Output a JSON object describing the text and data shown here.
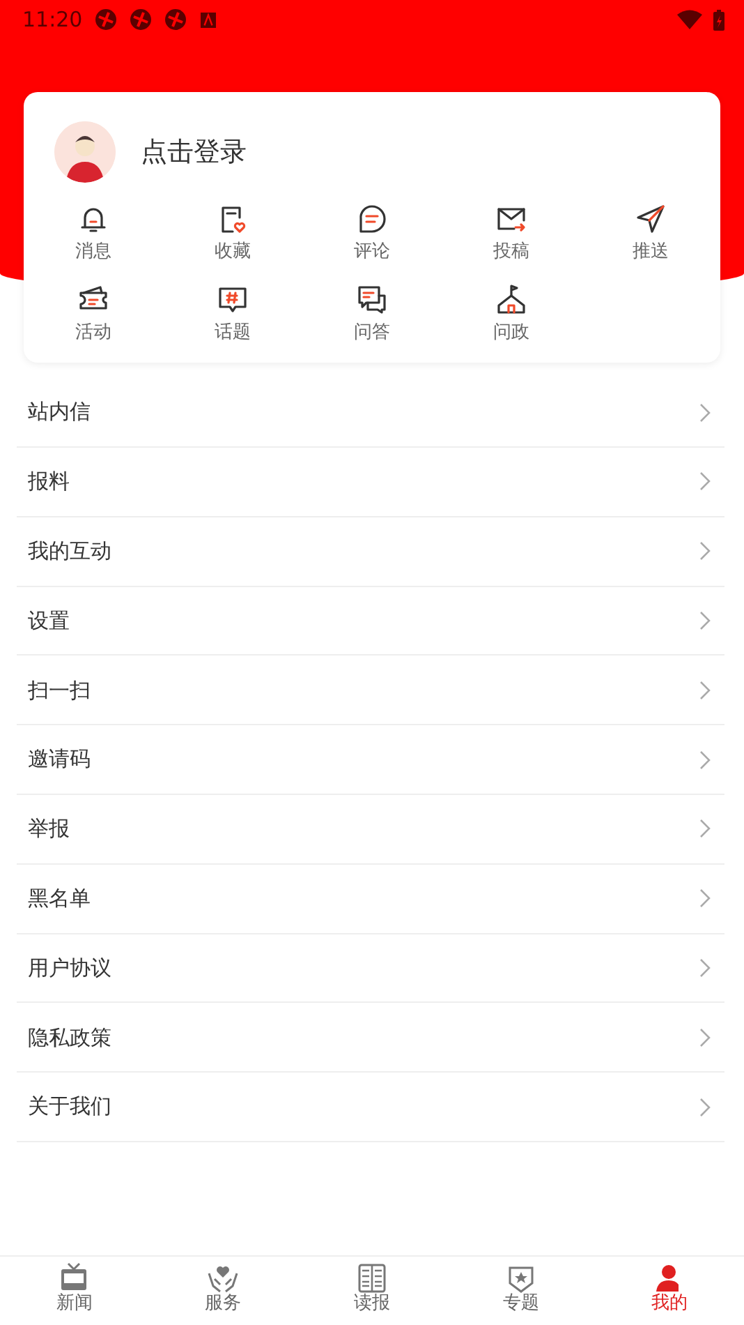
{
  "status_bar": {
    "time": "11:20"
  },
  "profile": {
    "login_label": "点击登录"
  },
  "shortcuts": [
    {
      "label": "消息"
    },
    {
      "label": "收藏"
    },
    {
      "label": "评论"
    },
    {
      "label": "投稿"
    },
    {
      "label": "推送"
    },
    {
      "label": "活动"
    },
    {
      "label": "话题"
    },
    {
      "label": "问答"
    },
    {
      "label": "问政"
    }
  ],
  "menu": [
    {
      "label": "站内信"
    },
    {
      "label": "报料"
    },
    {
      "label": "我的互动"
    },
    {
      "label": "设置"
    },
    {
      "label": "扫一扫"
    },
    {
      "label": "邀请码"
    },
    {
      "label": "举报"
    },
    {
      "label": "黑名单"
    },
    {
      "label": "用户协议"
    },
    {
      "label": "隐私政策"
    },
    {
      "label": "关于我们"
    }
  ],
  "bottom_nav": [
    {
      "label": "新闻",
      "selected": false
    },
    {
      "label": "服务",
      "selected": false
    },
    {
      "label": "读报",
      "selected": false
    },
    {
      "label": "专题",
      "selected": false
    },
    {
      "label": "我的",
      "selected": true
    }
  ]
}
